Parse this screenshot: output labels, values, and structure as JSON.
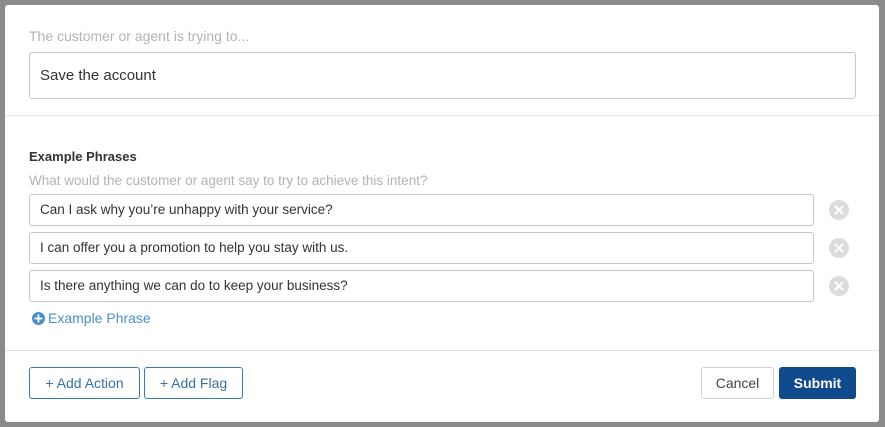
{
  "intent": {
    "hint": "The customer or agent is trying to...",
    "value": "Save the account"
  },
  "example_phrases": {
    "title": "Example Phrases",
    "hint": "What would the customer or agent say to try to achieve this intent?",
    "items": [
      {
        "text": "Can I ask why you’re unhappy with your service?"
      },
      {
        "text": "I can offer you a promotion to help you stay with us."
      },
      {
        "text": "Is there anything we can do to keep your business?"
      }
    ],
    "add_label": "Example Phrase"
  },
  "footer": {
    "add_action_label": "+ Add Action",
    "add_flag_label": "+ Add Flag",
    "cancel_label": "Cancel",
    "submit_label": "Submit"
  },
  "colors": {
    "primary": "#0f4a8c",
    "link": "#4a90c8",
    "backdrop": "#8a8a8a"
  },
  "icons": {
    "remove": "close-circle-icon",
    "add": "plus-circle-icon"
  }
}
